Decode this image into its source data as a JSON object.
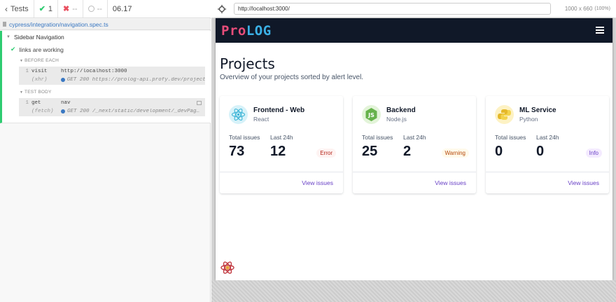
{
  "runner": {
    "back_label": "Tests",
    "passed": "1",
    "failed": "--",
    "pending": "--",
    "duration": "06.17",
    "spec_file": "cypress/integration/navigation.spec.ts",
    "suite_title": "Sidebar Navigation",
    "test_title": "links are working",
    "hooks": {
      "before_each": "BEFORE EACH",
      "test_body": "TEST BODY"
    },
    "commands": [
      {
        "num": "1",
        "name": "visit",
        "message": "http://localhost:3000"
      },
      {
        "num": "",
        "name": "(xhr)",
        "message": "GET 200 https://prolog-api.profy.dev/project"
      },
      {
        "num": "1",
        "name": "get",
        "message": "nav"
      },
      {
        "num": "",
        "name": "(fetch)",
        "message": "GET 200 /_next/static/development/_devPagesManifest.json"
      }
    ]
  },
  "browser": {
    "url": "http://localhost:3000/",
    "viewport": "1000 x 660",
    "zoom": "(100%)"
  },
  "app": {
    "logo_part1": "Pro",
    "logo_part2": "LOG",
    "title": "Projects",
    "subtitle": "Overview of your projects sorted by alert level.",
    "total_label": "Total issues",
    "last_label": "Last 24h",
    "view_label": "View issues",
    "projects": [
      {
        "name": "Frontend - Web",
        "language": "React",
        "total": "73",
        "last24": "12",
        "status": "Error",
        "icon": "react-icon",
        "badge_bg": "#fef3f2",
        "badge_fg": "#b42318"
      },
      {
        "name": "Backend",
        "language": "Node.js",
        "total": "25",
        "last24": "2",
        "status": "Warning",
        "icon": "nodejs-icon",
        "badge_bg": "#fffaeb",
        "badge_fg": "#b54708"
      },
      {
        "name": "ML Service",
        "language": "Python",
        "total": "0",
        "last24": "0",
        "status": "Info",
        "icon": "python-icon",
        "badge_bg": "#f4ebff",
        "badge_fg": "#6941c6"
      }
    ]
  }
}
